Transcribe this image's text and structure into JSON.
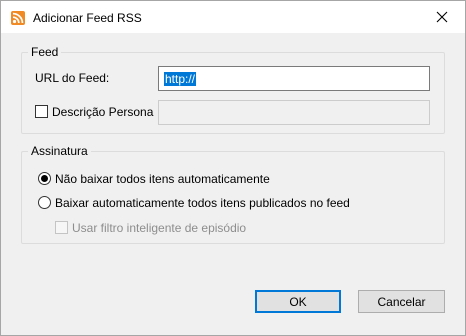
{
  "window": {
    "title": "Adicionar Feed RSS",
    "icon": "rss-icon",
    "close_icon": "close-icon"
  },
  "feed_group": {
    "title": "Feed",
    "url_label": "URL do Feed:",
    "url_value": "http://",
    "custom_description_label": "Descrição Persona",
    "custom_description_checked": false,
    "custom_description_value": ""
  },
  "subscription_group": {
    "title": "Assinatura",
    "options": [
      {
        "label": "Não baixar todos itens automaticamente",
        "selected": true
      },
      {
        "label": "Baixar automaticamente todos itens publicados no feed",
        "selected": false
      }
    ],
    "smart_filter_label": "Usar filtro inteligente de episódio",
    "smart_filter_checked": false,
    "smart_filter_enabled": false
  },
  "buttons": {
    "ok_label": "OK",
    "cancel_label": "Cancelar"
  },
  "colors": {
    "accent": "#0078d7",
    "rss_orange": "#f08a24",
    "dialog_bg": "#f0f0f0"
  }
}
